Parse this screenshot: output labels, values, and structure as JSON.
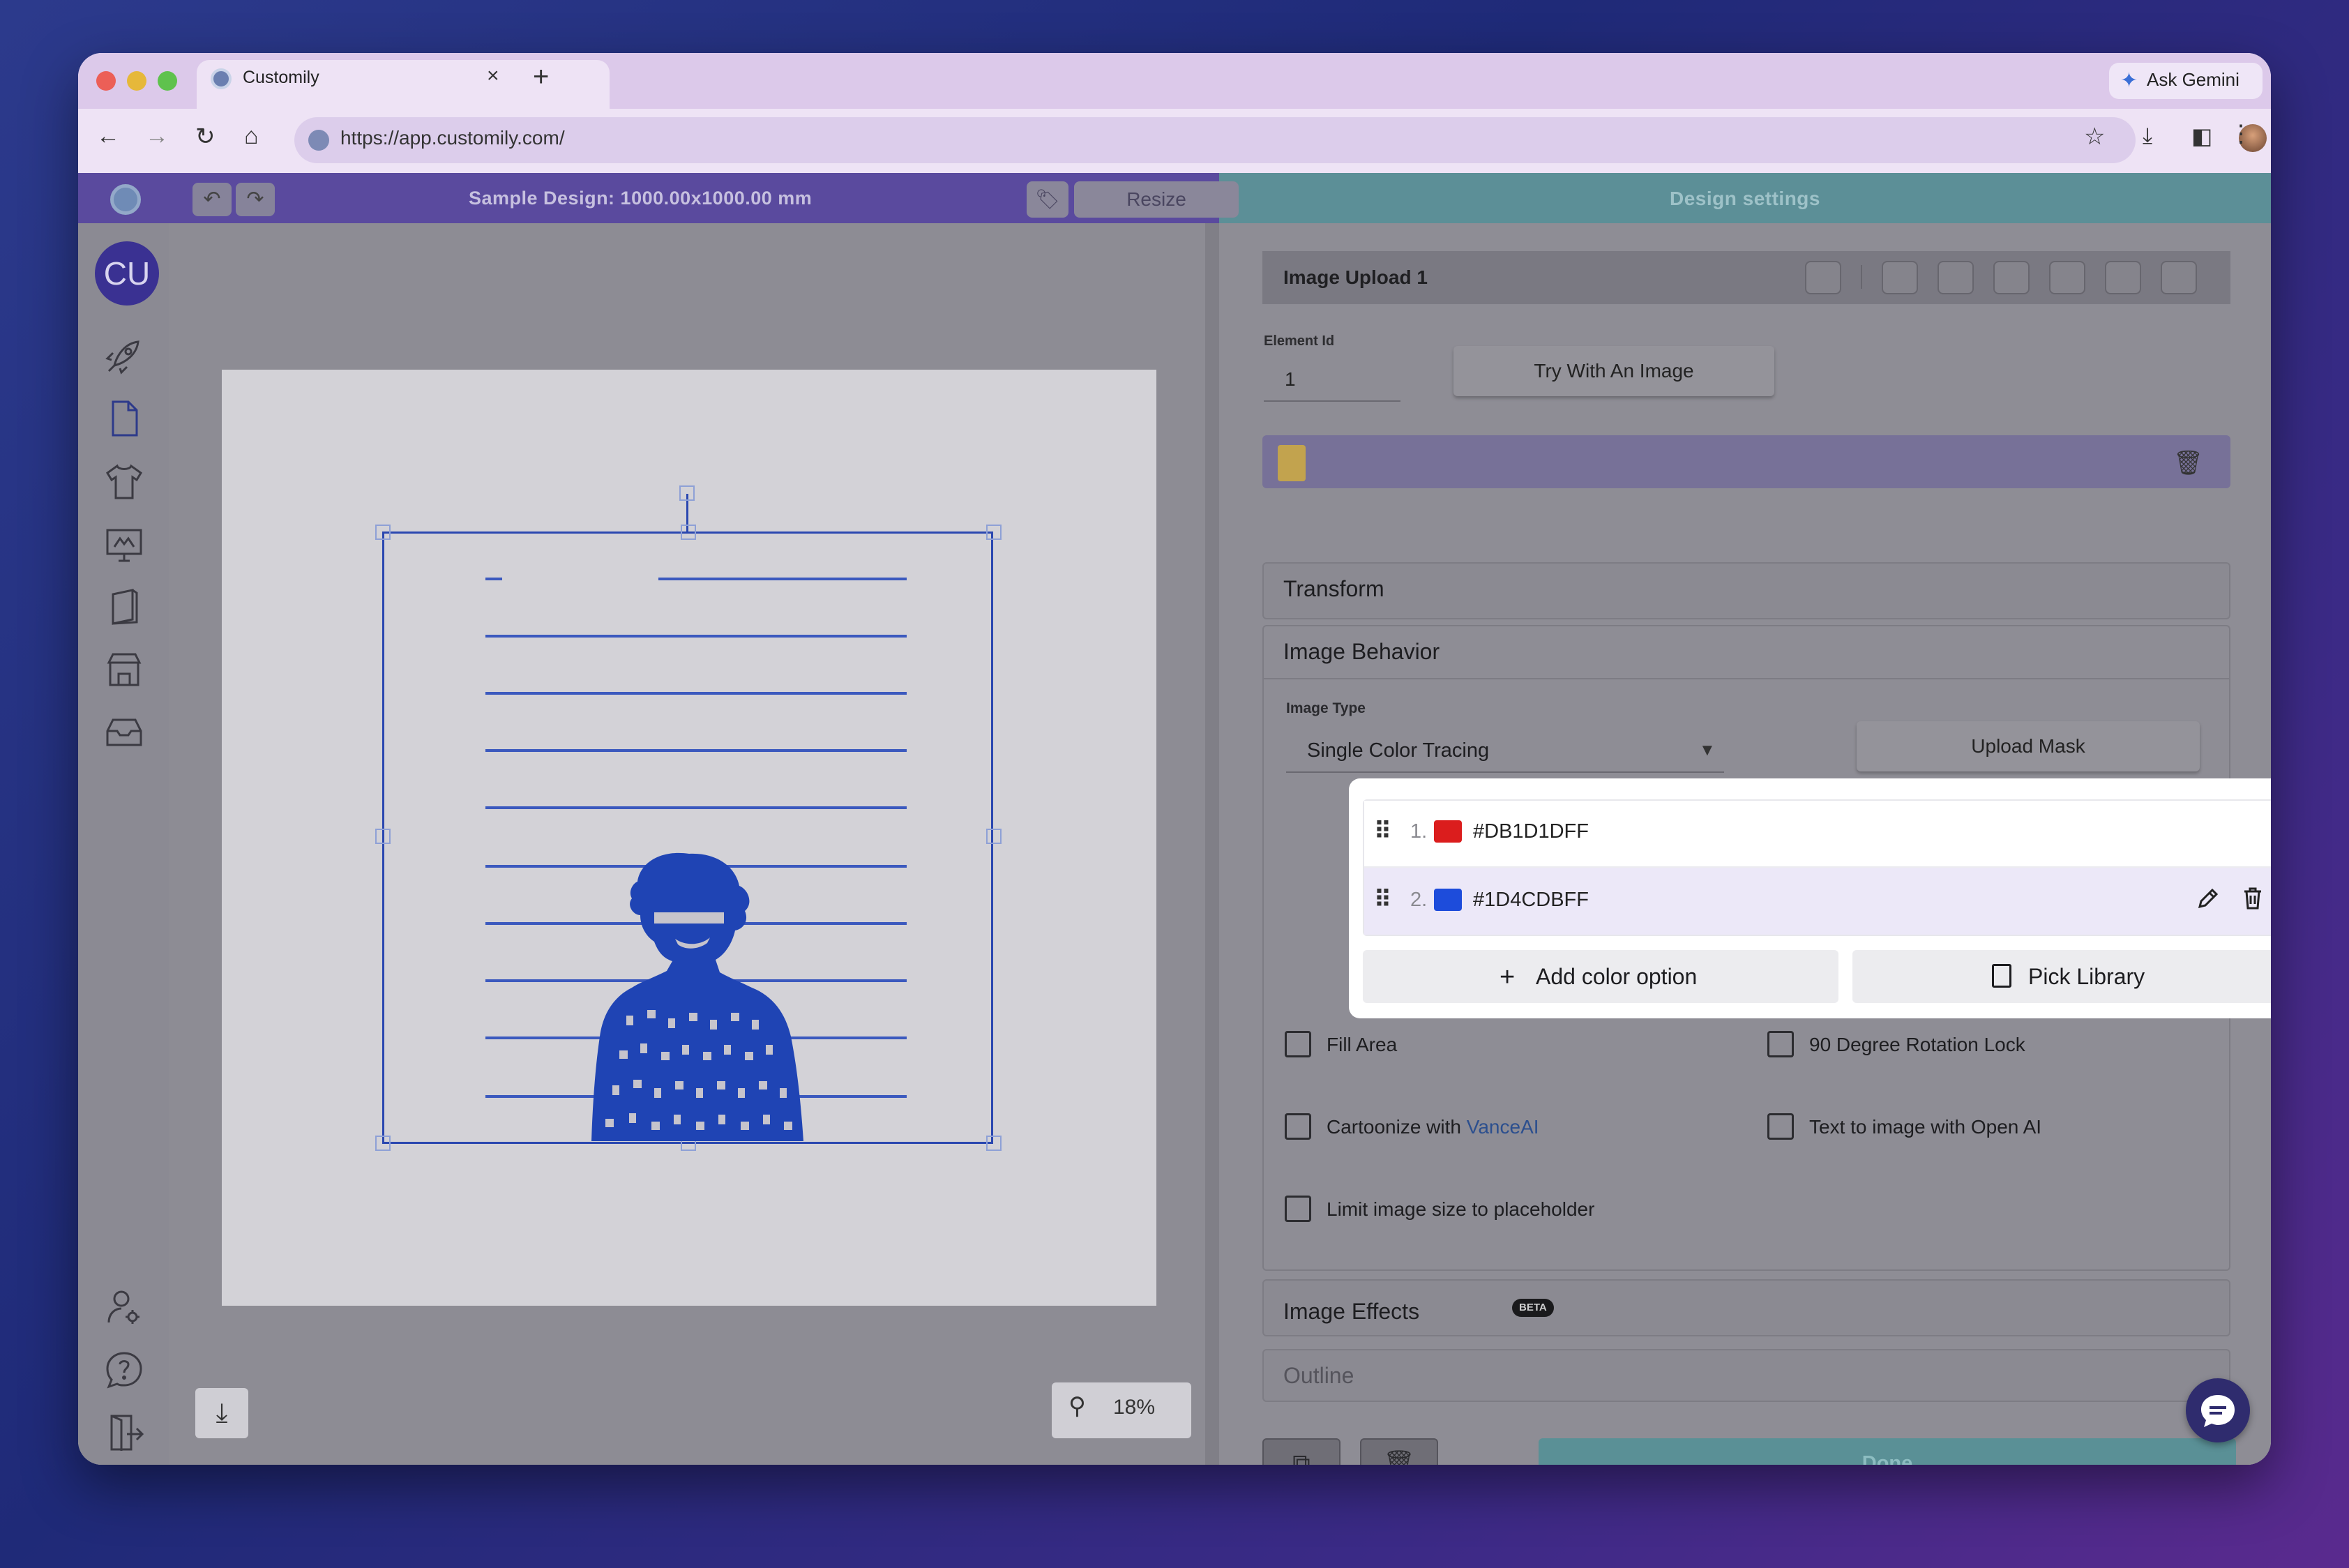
{
  "browser": {
    "tab_title": "Customily",
    "tab_close": "×",
    "new_tab": "+",
    "ask_gemini": "Ask Gemini",
    "url": "https://app.customily.com/",
    "nav": {
      "back": "←",
      "forward": "→",
      "reload": "↻",
      "home": "⌂"
    }
  },
  "app": {
    "design_title": "Sample Design: 1000.00x1000.00 mm",
    "resize_label": "Resize",
    "settings_title": "Design settings",
    "avatar_initials": "CU",
    "zoom_value": "18%"
  },
  "panel": {
    "element_title": "Image Upload 1",
    "element_id_label": "Element Id",
    "element_id_value": "1",
    "try_image_label": "Try With An Image",
    "sections": {
      "transform": "Transform",
      "image_behavior": "Image Behavior",
      "image_effects": "Image Effects",
      "outline": "Outline"
    },
    "beta_badge": "BETA",
    "image_type_label": "Image Type",
    "image_type_value": "Single Color Tracing",
    "upload_mask_label": "Upload Mask",
    "colors": [
      {
        "index": "1.",
        "hex": "#DB1D1DFF",
        "swatch": "#DB1D1D"
      },
      {
        "index": "2.",
        "hex": "#1D4CDBFF",
        "swatch": "#1D4CDB"
      }
    ],
    "add_color_label": "Add color option",
    "pick_library_label": "Pick Library",
    "checkboxes": {
      "fill_area": "Fill Area",
      "rotation_lock": "90 Degree Rotation Lock",
      "cartoonize_prefix": "Cartoonize with ",
      "cartoonize_link": "VanceAI",
      "text_to_image": "Text to image with Open AI",
      "limit_size": "Limit image size to placeholder"
    },
    "done_label": "Done"
  },
  "colors": {
    "header_left": "#5a4a9e",
    "header_right": "#5c8f97",
    "trace_blue": "#2a4bbb",
    "done_button": "#5a9096"
  },
  "icons": [
    "rocket-icon",
    "document-icon",
    "tshirt-icon",
    "monitor-icon",
    "book-icon",
    "store-icon",
    "inbox-icon",
    "user-settings-icon",
    "help-icon",
    "logout-icon",
    "search-icon",
    "download-icon",
    "trash-icon",
    "pencil-icon",
    "drag-handle-icon",
    "chat-icon"
  ]
}
